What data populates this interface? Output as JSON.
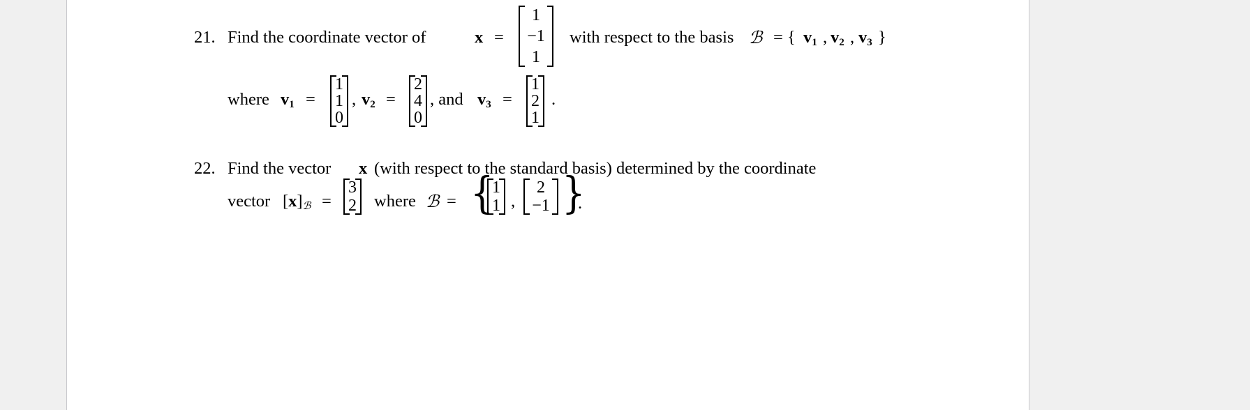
{
  "problems": [
    {
      "number": "21.",
      "line1": {
        "lead": "Find the coordinate vector of",
        "x_symbol": "x",
        "equals": "=",
        "x_vector": [
          "1",
          "−1",
          "1"
        ],
        "mid": "with respect to the basis",
        "basis_symbol": "ℬ",
        "basis_set_open": "= {",
        "v1": "v",
        "v1_sub": "1",
        "sep1": ",",
        "v2": "v",
        "v2_sub": "2",
        "sep2": ",",
        "v3": "v",
        "v3_sub": "3",
        "basis_set_close": "}"
      },
      "line2": {
        "where": "where",
        "v1_label": "v",
        "v1_sub": "1",
        "eq": "=",
        "v1": [
          "1",
          "1",
          "0"
        ],
        "comma1": ",",
        "v2_label": "v",
        "v2_sub": "2",
        "v2": [
          "2",
          "4",
          "0"
        ],
        "and": ", and",
        "v3_label": "v",
        "v3_sub": "3",
        "v3": [
          "1",
          "2",
          "1"
        ],
        "period": "."
      }
    },
    {
      "number": "22.",
      "line1": "Find the vector",
      "x_symbol": "x",
      "line1_rest": "(with respect to the standard basis) determined by the coordinate",
      "line2": {
        "vector_word": "vector",
        "coord_open": "[",
        "coord_x": "x",
        "coord_close": "]",
        "coord_sub": "ℬ",
        "eq": "=",
        "coord_vector": [
          "3",
          "2"
        ],
        "where": "where",
        "basis_symbol": "ℬ",
        "eq2": "=",
        "basis_b1": [
          "1",
          "1"
        ],
        "comma": ",",
        "basis_b2": [
          "2",
          "−1"
        ],
        "brace_open": "{",
        "brace_close": "}",
        "period": "."
      }
    }
  ]
}
